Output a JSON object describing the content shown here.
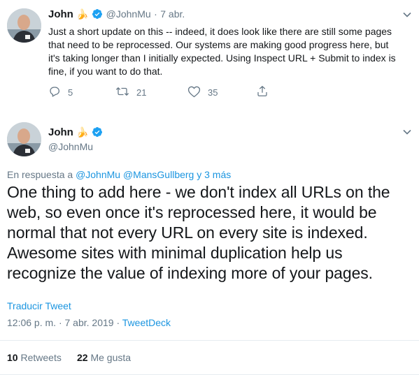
{
  "tweet1": {
    "name": "John",
    "name_emoji": "🍌",
    "handle": "@JohnMu",
    "separator": "·",
    "date": "7 abr.",
    "text": "Just a short update on this -- indeed, it does look like there are still some pages that need to be reprocessed. Our systems are making good progress here, but it's taking longer than I initially expected. Using Inspect URL + Submit to index is fine, if you want to do that.",
    "replies": "5",
    "retweets": "21",
    "likes": "35"
  },
  "tweet2": {
    "name": "John",
    "name_emoji": "🍌",
    "handle": "@JohnMu",
    "reply_prefix": "En respuesta a",
    "reply_mentions": "@JohnMu @MansGullberg",
    "reply_more": "y 3 más",
    "text": "One thing to add here - we don't index all URLs on the web, so even once it's reprocessed here, it would be normal that not every URL on every site is indexed. Awesome sites with minimal duplication help us recognize the value of indexing more of your pages.",
    "translate_label": "Traducir Tweet",
    "time": "12:06 p. m.",
    "meta_sep": "·",
    "date": "7 abr. 2019",
    "client": "TweetDeck",
    "retweet_count": "10",
    "retweet_label": "Retweets",
    "like_count": "22",
    "like_label": "Me gusta"
  },
  "colors": {
    "verified": "#1da1f2",
    "link": "#1b95e0",
    "muted": "#657786",
    "text": "#14171a",
    "divider": "#e6ecf0"
  },
  "icons": [
    "chevron-down-icon",
    "verified-badge-icon",
    "reply-icon",
    "retweet-icon",
    "like-icon",
    "share-icon"
  ]
}
